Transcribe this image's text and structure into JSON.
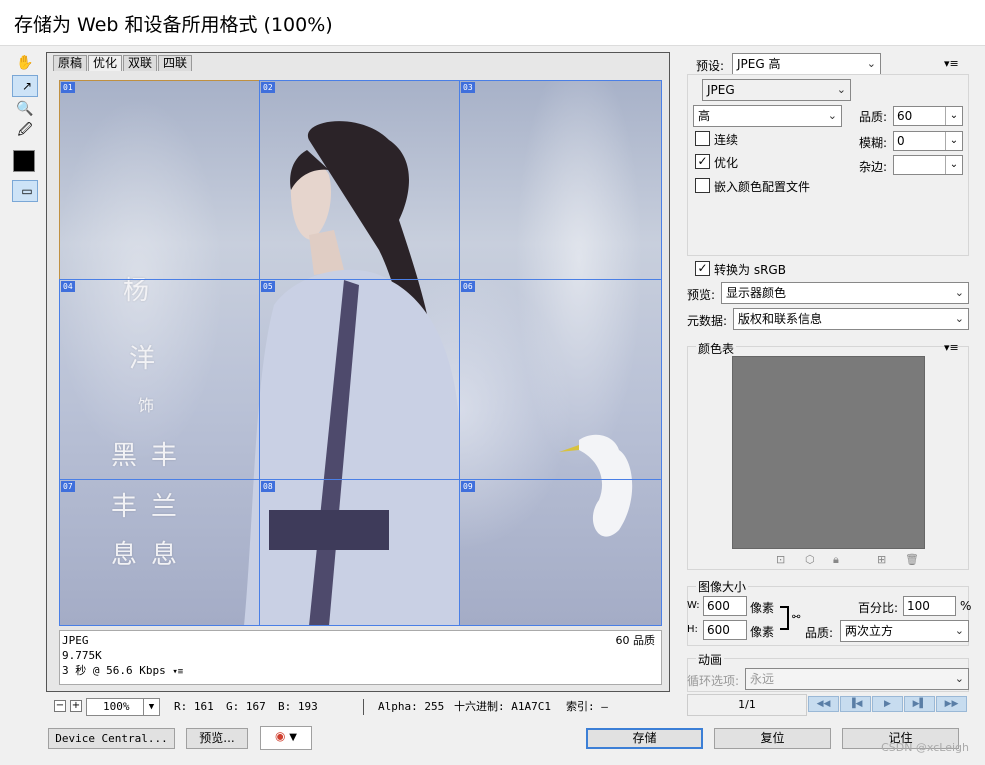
{
  "window": {
    "title": "存储为 Web 和设备所用格式 (100%)"
  },
  "tools": {
    "hand": "hand-icon",
    "slice_select": "slice-select-icon",
    "zoom": "zoom-icon",
    "eyedropper": "eyedropper-icon",
    "color": "#000000",
    "preview_toggle": "preview-icon"
  },
  "tabs": [
    "原稿",
    "优化",
    "双联",
    "四联"
  ],
  "slices": [
    "01",
    "02",
    "03",
    "04",
    "05",
    "06",
    "07",
    "08",
    "09"
  ],
  "image_text": {
    "c1": "杨",
    "c2": "洋",
    "c3": "饰",
    "c4": "黑",
    "c5": "丰",
    "c6": "丰",
    "c7": "兰",
    "c8": "息",
    "c9": "息"
  },
  "info": {
    "format": "JPEG",
    "size": "9.775K",
    "time": "3 秒 @ 56.6 Kbps",
    "quality": "60 品质"
  },
  "status": {
    "zoom": "100%",
    "r": "R: 161",
    "g": "G: 167",
    "b": "B: 193",
    "alpha": "Alpha: 255",
    "hex": "十六进制: A1A7C1",
    "index": "索引: —"
  },
  "buttons": {
    "device_central": "Device Central...",
    "preview": "预览...",
    "save": "存储",
    "reset": "复位",
    "remember": "记住"
  },
  "panel": {
    "preset_label": "预设:",
    "preset_value": "JPEG 高",
    "format_value": "JPEG",
    "quality_level": "高",
    "quality_label": "品质:",
    "quality_value": "60",
    "blur_label": "模糊:",
    "blur_value": "0",
    "matte_label": "杂边:",
    "matte_value": "",
    "progressive": "连续",
    "progressive_checked": false,
    "optimized": "优化",
    "optimized_checked": true,
    "embed_profile": "嵌入颜色配置文件",
    "embed_checked": false,
    "srgb": "转换为 sRGB",
    "srgb_checked": true,
    "preview_label": "预览:",
    "preview_value": "显示器颜色",
    "metadata_label": "元数据:",
    "metadata_value": "版权和联系信息",
    "color_table": "颜色表",
    "image_size": "图像大小",
    "w_label": "W:",
    "w_value": "600",
    "h_label": "H:",
    "h_value": "600",
    "unit": "像素",
    "percent_label": "百分比:",
    "percent_value": "100",
    "percent_sign": "%",
    "resample_label": "品质:",
    "resample_value": "两次立方",
    "animation": "动画",
    "loop_label": "循环选项:",
    "loop_value": "永远",
    "frame": "1/1"
  },
  "check_glyph": "✓",
  "watermark": "CSDN @xcLeigh"
}
